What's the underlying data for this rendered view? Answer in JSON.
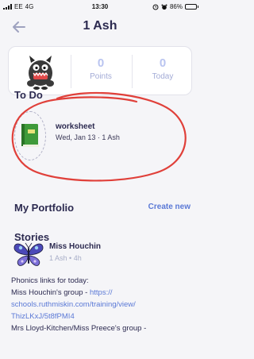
{
  "status_bar": {
    "carrier": "EE",
    "network": "4G",
    "time": "13:30",
    "battery": "86%"
  },
  "header": {
    "title": "1 Ash"
  },
  "stats": {
    "points_value": "0",
    "points_label": "Points",
    "today_value": "0",
    "today_label": "Today"
  },
  "todo": {
    "title": "To Do",
    "item_name": "worksheet",
    "item_meta": "Wed, Jan 13 · 1 Ash"
  },
  "portfolio": {
    "title": "My Portfolio",
    "create_new": "Create new"
  },
  "stories": {
    "title": "Stories",
    "author": "Miss Houchin",
    "class_name": "1 Ash",
    "time_ago": "4h",
    "text_line1": "Phonics links for today:",
    "text_line2_prefix": "Miss Houchin's group - ",
    "text_line2_link": "https://",
    "text_line3": "schools.ruthmiskin.com/training/view/",
    "text_line4": "ThizLKxJ/5t8fPMI4",
    "text_line5": "Mrs Lloyd-Kitchen/Miss Preece's group -"
  },
  "colors": {
    "title": "#2c2a50",
    "link": "#5b79d6",
    "annotation": "#e0403a",
    "stat_number": "#b9c4f0"
  },
  "icons": {
    "back": "arrow-left-icon",
    "avatar": "monster-avatar",
    "todo": "green-book-icon",
    "story": "butterfly-icon",
    "alarm": "alarm-icon"
  }
}
